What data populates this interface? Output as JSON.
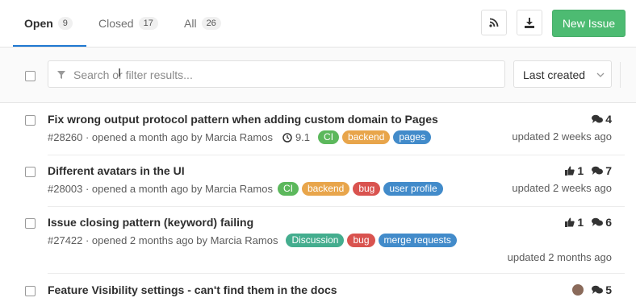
{
  "tabs": [
    {
      "label": "Open",
      "count": "9"
    },
    {
      "label": "Closed",
      "count": "17"
    },
    {
      "label": "All",
      "count": "26"
    }
  ],
  "toolbar": {
    "new_issue_label": "New Issue",
    "rss_icon": "rss-icon",
    "download_icon": "download-icon"
  },
  "filter": {
    "search_placeholder": "Search or filter results...",
    "sort_label": "Last created"
  },
  "issues": [
    {
      "title": "Fix wrong output protocol pattern when adding custom domain to Pages",
      "meta": "#28260 · opened a month ago by Marcia Ramos",
      "milestone": "9.1",
      "labels": [
        {
          "text": "CI",
          "color": "#5cb85c"
        },
        {
          "text": "backend",
          "color": "#e8a54b"
        },
        {
          "text": "pages",
          "color": "#428bca"
        }
      ],
      "upvotes": "",
      "comments": "4",
      "updated": "updated 2 weeks ago"
    },
    {
      "title": "Different avatars in the UI",
      "meta": "#28003 · opened a month ago by Marcia Ramos",
      "milestone": "",
      "labels": [
        {
          "text": "CI",
          "color": "#5cb85c"
        },
        {
          "text": "backend",
          "color": "#e8a54b"
        },
        {
          "text": "bug",
          "color": "#d9534f"
        },
        {
          "text": "user profile",
          "color": "#428bca"
        }
      ],
      "upvotes": "1",
      "comments": "7",
      "updated": "updated 2 weeks ago"
    },
    {
      "title": "Issue closing pattern (keyword) failing",
      "meta": "#27422 · opened 2 months ago by Marcia Ramos",
      "milestone": "",
      "labels": [
        {
          "text": "Discussion",
          "color": "#44ad8e"
        },
        {
          "text": "bug",
          "color": "#d9534f"
        },
        {
          "text": "merge requests",
          "color": "#428bca"
        }
      ],
      "upvotes": "1",
      "comments": "6",
      "updated": "updated 2 months ago"
    },
    {
      "title": "Feature Visibility settings - can't find them in the docs",
      "meta": "",
      "milestone": "",
      "labels": [],
      "upvotes": "",
      "comments": "5",
      "updated": ""
    }
  ],
  "colors": {
    "accent": "#1f78d1",
    "success": "#4dbb72"
  }
}
